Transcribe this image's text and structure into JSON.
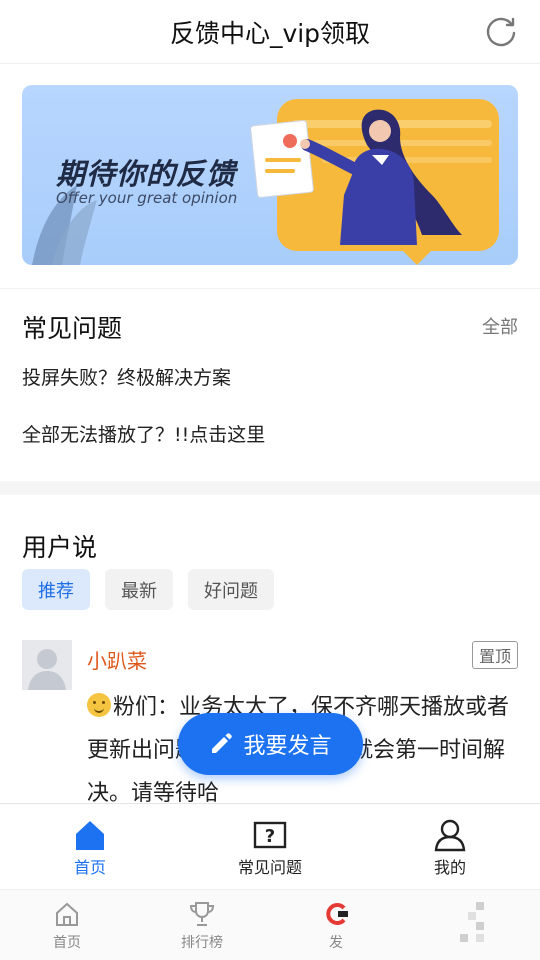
{
  "header": {
    "title": "反馈中心_vip领取",
    "refresh_icon": "refresh-icon"
  },
  "banner": {
    "title": "期待你的反馈",
    "subtitle": "Offer your great opinion"
  },
  "faq": {
    "title": "常见问题",
    "all_label": "全部",
    "items": [
      "投屏失败？终极解决方案",
      "全部无法播放了？!!点击这里"
    ]
  },
  "users": {
    "title": "用户说",
    "chips": [
      "推荐",
      "最新",
      "好问题"
    ],
    "post": {
      "name": "小趴菜",
      "pin_label": "置顶",
      "text": "粉们：业务太大了，保不齐哪天播放或者更新出问题，出现问题发现就会第一时间解决。请等待哈"
    }
  },
  "fab": {
    "label": "我要发言"
  },
  "tabbar": {
    "items": [
      "首页",
      "常见问题",
      "我的"
    ]
  },
  "tabbar2": {
    "items": [
      "首页",
      "排行榜",
      "发"
    ]
  },
  "colors": {
    "accent": "#1d72f2",
    "name_color": "#e0581c",
    "banner_card": "#f6b93b"
  }
}
